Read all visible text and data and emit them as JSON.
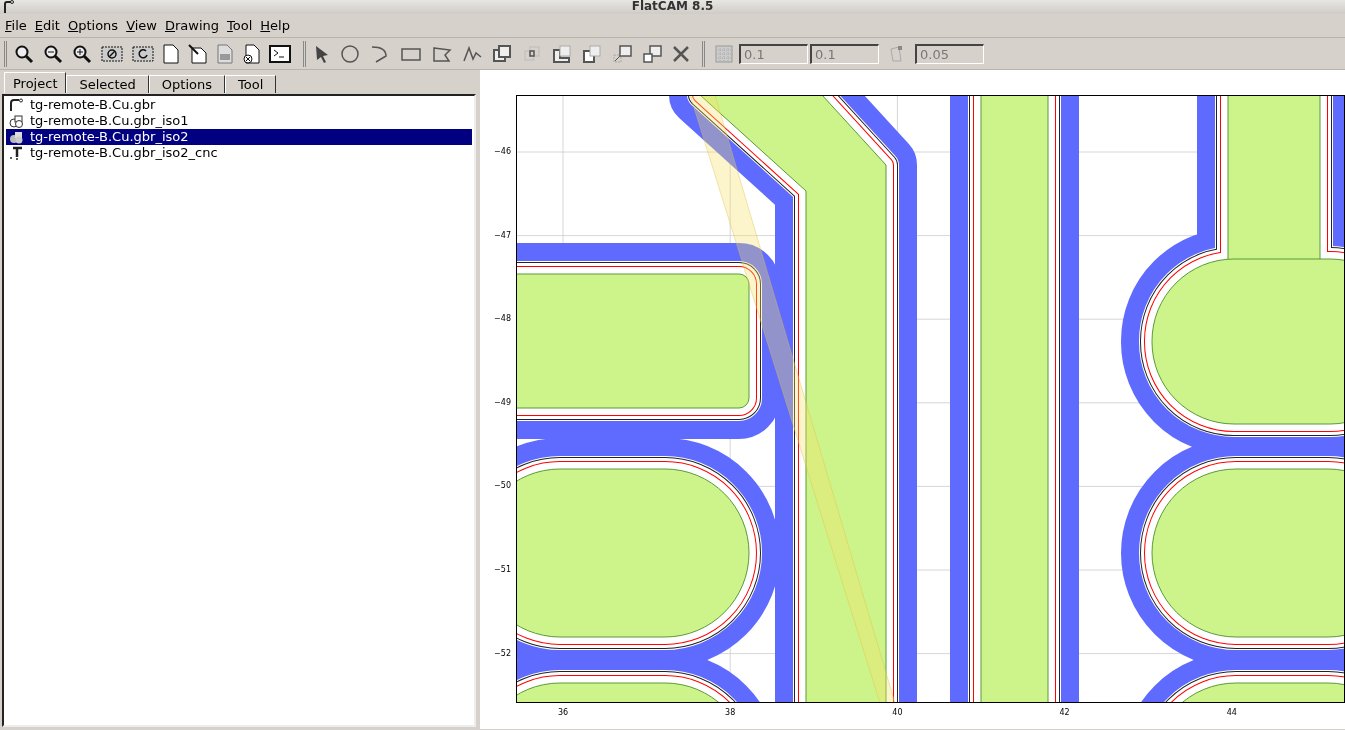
{
  "window": {
    "title": "FlatCAM 8.5"
  },
  "menu": [
    "File",
    "Edit",
    "Options",
    "View",
    "Drawing",
    "Tool",
    "Help"
  ],
  "toolbar": {
    "fields": [
      {
        "value": "0.1",
        "disabled": true
      },
      {
        "value": "0.1",
        "disabled": true
      },
      {
        "value": "0.05",
        "disabled": true
      }
    ]
  },
  "tabs": [
    {
      "label": "Project",
      "selected": true
    },
    {
      "label": "Selected",
      "selected": false
    },
    {
      "label": "Options",
      "selected": false
    },
    {
      "label": "Tool",
      "selected": false
    }
  ],
  "project_tree": [
    {
      "kind": "gerber",
      "label": "tg-remote-B.Cu.gbr",
      "selected": false
    },
    {
      "kind": "geometry",
      "label": "tg-remote-B.Cu.gbr_iso1",
      "selected": false
    },
    {
      "kind": "geometry",
      "label": "tg-remote-B.Cu.gbr_iso2",
      "selected": true
    },
    {
      "kind": "cnc",
      "label": "tg-remote-B.Cu.gbr_iso2_cnc",
      "selected": false
    }
  ],
  "plot": {
    "xticks": [
      "36",
      "38",
      "40",
      "42",
      "44"
    ],
    "yticks": [
      "−46",
      "−47",
      "−48",
      "−49",
      "−50",
      "−51",
      "−52"
    ]
  }
}
